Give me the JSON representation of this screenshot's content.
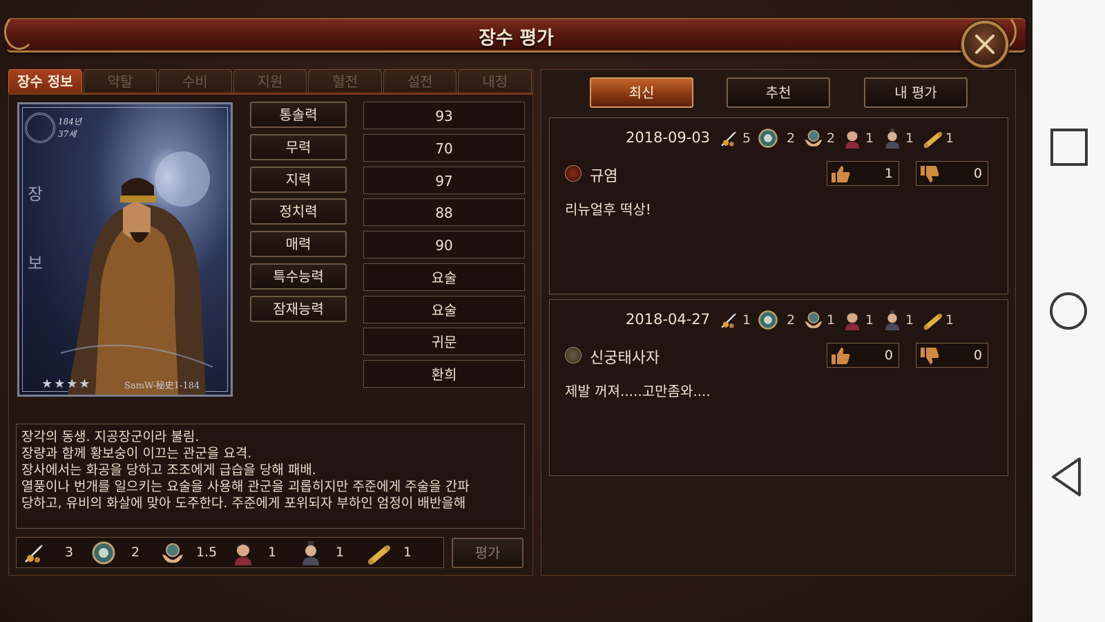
{
  "title": "장수 평가",
  "tabs": [
    "장수 정보",
    "약탈",
    "수비",
    "지원",
    "혈전",
    "설전",
    "내정"
  ],
  "portrait": {
    "age_line1": "184년",
    "age_line2": "37세",
    "name": "장보",
    "stars": "★★★★",
    "code": "SamW-秘史1-184"
  },
  "stats": [
    {
      "label": "통솔력",
      "value": "93"
    },
    {
      "label": "무력",
      "value": "70"
    },
    {
      "label": "지력",
      "value": "97"
    },
    {
      "label": "정치력",
      "value": "88"
    },
    {
      "label": "매력",
      "value": "90"
    },
    {
      "label": "특수능력",
      "value": "요술"
    },
    {
      "label": "잠재능력",
      "value": "요술"
    },
    {
      "label": "",
      "value": "귀문"
    },
    {
      "label": "",
      "value": "환희"
    }
  ],
  "description": [
    "장각의 동생. 지공장군이라 불림.",
    "장량과 함께 황보숭이 이끄는 관군을 요격.",
    "장사에서는 화공을 당하고 조조에게 급습을 당해 패배.",
    "열풍이나 번개를 일으키는 요술을 사용해 관군을 괴롭히지만 주준에게 주술을 간파",
    "당하고, 유비의 화살에 맞아 도주한다. 주준에게 포위되자 부하인 엄정이 배반을해"
  ],
  "ratings": [
    {
      "icon": "sword-raid-icon",
      "value": "3"
    },
    {
      "icon": "shield-defense-icon",
      "value": "2"
    },
    {
      "icon": "hands-support-icon",
      "value": "1.5"
    },
    {
      "icon": "warrior-bloodbattle-icon",
      "value": "1"
    },
    {
      "icon": "scholar-debate-icon",
      "value": "1"
    },
    {
      "icon": "scroll-domestic-icon",
      "value": "1"
    }
  ],
  "evaluate_label": "평가",
  "filters": [
    "최신",
    "추천",
    "내 평가"
  ],
  "reviews": [
    {
      "date": "2018-09-03",
      "stats": [
        "5",
        "2",
        "2",
        "1",
        "1",
        "1"
      ],
      "author": "규염",
      "likes": "1",
      "dislikes": "0",
      "text": "리뉴얼후 떡상!"
    },
    {
      "date": "2018-04-27",
      "stats": [
        "1",
        "2",
        "1",
        "1",
        "1",
        "1"
      ],
      "author": "신궁태사자",
      "likes": "0",
      "dislikes": "0",
      "text": "제발 꺼져.....고만좀와...."
    }
  ],
  "colors": {
    "title_bar": "#5a1a10",
    "active_tab": "#a8421e",
    "active_filter": "#c2632a",
    "panel_bg": "#241611",
    "border": "#6a5240"
  }
}
